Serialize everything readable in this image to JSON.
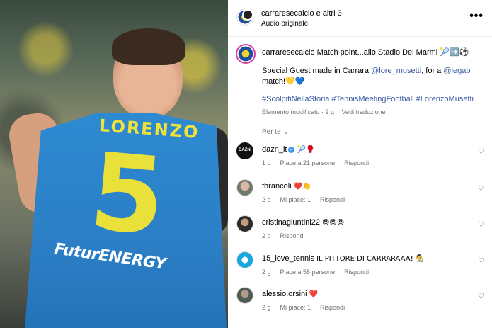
{
  "header": {
    "title": "carraresecalcio e altri 3",
    "subtitle": "Audio originale",
    "more_icon": "•••"
  },
  "media": {
    "shirt_name": "LORENZO",
    "shirt_number": "5",
    "sponsor": "FuturENERGY"
  },
  "caption": {
    "user": "carraresecalcio",
    "text": "Match point...allo Stadio Dei Marmi 🎾➡️⚽",
    "line2_prefix": "Special Guest made in Carrara ",
    "mention1": "@lore_musetti",
    "line2_mid": ", for a ",
    "mention2": "@legab",
    "line2_suffix": " match!💛💙",
    "hashtags": "#ScolpitiNellaStoria #TennisMeetingFootball #LorenzoMusetti",
    "meta_edited": "Elemento modificato · 2 g",
    "meta_translate": "Vedi traduzione"
  },
  "for_you": "Per te ⌄",
  "comments": [
    {
      "user": "dazn_it",
      "verified": true,
      "text": "🎾🥊",
      "time": "1 g",
      "likes": "Piace a 21 persone",
      "reply": "Rispondi"
    },
    {
      "user": "fbrancoli",
      "text": "❤️👏",
      "time": "2 g",
      "likes": "Mi piace: 1",
      "reply": "Rispondi"
    },
    {
      "user": "cristinagiuntini22",
      "text": "😍😍😍",
      "time": "2 g",
      "likes": "",
      "reply": "Rispondi"
    },
    {
      "user": "15_love_tennis",
      "text": "IL PITTORE DI CARRARAAA! 👨‍🎨",
      "time": "2 g",
      "likes": "Piace a 58 persone",
      "reply": "Rispondi"
    },
    {
      "user": "alessio.orsini",
      "text": "❤️",
      "time": "2 g",
      "likes": "Mi piace: 1",
      "reply": "Rispondi"
    }
  ],
  "icons": {
    "heart": "♡"
  }
}
